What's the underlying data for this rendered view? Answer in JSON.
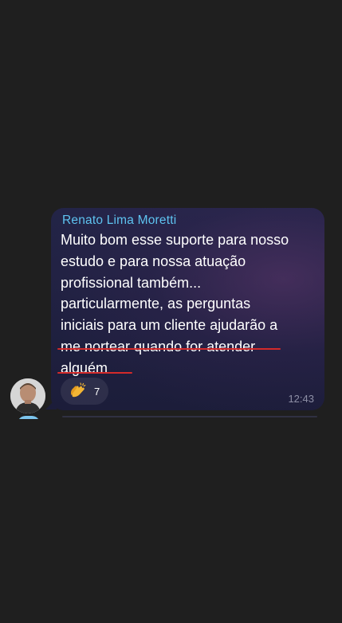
{
  "message": {
    "sender": "Renato Lima Moretti",
    "lines": [
      "Muito bom esse suporte para nosso",
      "estudo e para nossa atuação",
      "profissional também...",
      "particularmente, as perguntas",
      "iniciais para um cliente ajudarão a",
      "me nortear quando for atender",
      "alguém"
    ],
    "time": "12:43",
    "reaction": {
      "icon": "clapping-hands-icon",
      "count": "7"
    }
  },
  "colors": {
    "background": "#1f1f1f",
    "sender": "#5ec3f0",
    "underline": "#d42a2a",
    "time": "#8e8fa6"
  }
}
